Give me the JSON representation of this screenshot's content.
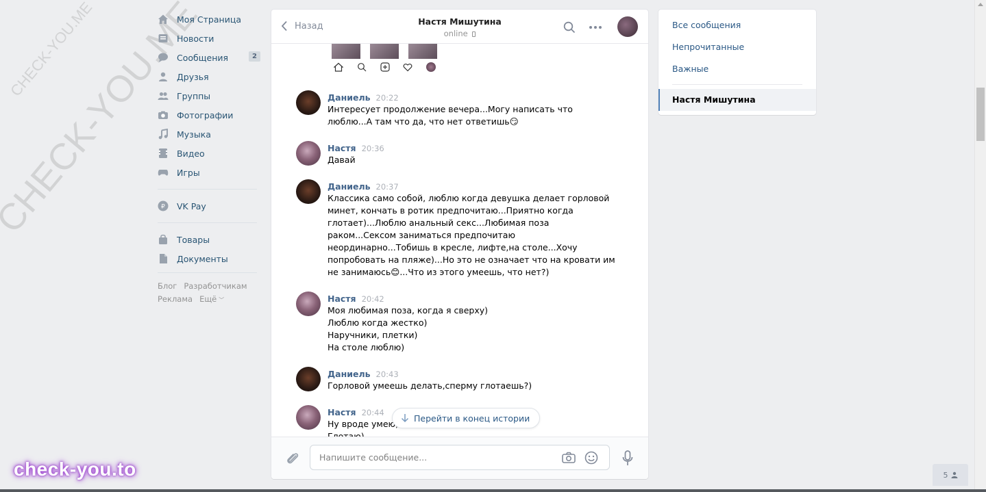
{
  "watermark": {
    "small": "CHECK-YOU.ME",
    "large": "CHECK-YOU.ME",
    "badge": "check-you.to"
  },
  "leftnav": {
    "items": [
      {
        "label": "Моя Страница",
        "icon": "home-icon"
      },
      {
        "label": "Новости",
        "icon": "news-icon"
      },
      {
        "label": "Сообщения",
        "icon": "messages-icon",
        "count": "2"
      },
      {
        "label": "Друзья",
        "icon": "friends-icon"
      },
      {
        "label": "Группы",
        "icon": "groups-icon"
      },
      {
        "label": "Фотографии",
        "icon": "camera-icon"
      },
      {
        "label": "Музыка",
        "icon": "music-icon"
      },
      {
        "label": "Видео",
        "icon": "video-icon"
      },
      {
        "label": "Игры",
        "icon": "games-icon"
      }
    ],
    "vkpay": {
      "label": "VK Pay",
      "icon": "vkpay-icon"
    },
    "extra": [
      {
        "label": "Товары",
        "icon": "bag-icon"
      },
      {
        "label": "Документы",
        "icon": "document-icon"
      }
    ],
    "footer": {
      "blog": "Блог",
      "dev": "Разработчикам",
      "ads": "Реклама",
      "more": "Ещё"
    }
  },
  "chat": {
    "back_label": "Назад",
    "title": "Настя Мишутина",
    "status": "online",
    "messages": [
      {
        "author": "Даниель",
        "time": "20:22",
        "type": "dan",
        "text": "Интересует продолжение вечера...Могу написать что\nлюблю...А там что да, что нет ответишь😏"
      },
      {
        "author": "Настя",
        "time": "20:36",
        "type": "nas",
        "text": "Давай"
      },
      {
        "author": "Даниель",
        "time": "20:37",
        "type": "dan",
        "text": "Классика само собой, люблю когда девушка делает горловой\nминет, кончать в ротик предпочитаю...Приятно когда\nглотает)...Люблю анальный секс...Любимая поза\nраком...Сексом заниматься предпочитаю\nнеординарно...Тобишь в кресле, лифте,на столе...Хочу\nпопробовать на пляже)...Но это не означает что на кровати им\nне занимаюсь😊...Что из этого умеешь, что нет?)"
      },
      {
        "author": "Настя",
        "time": "20:42",
        "type": "nas",
        "text": "Моя любимая поза, когда я сверху)\nЛюблю когда жестко)\nНаручники, плетки)\nНа столе люблю)"
      },
      {
        "author": "Даниель",
        "time": "20:43",
        "type": "dan",
        "text": "Горловой умеешь делать,сперму глотаешь?)"
      },
      {
        "author": "Настя",
        "time": "20:44",
        "type": "nas",
        "text": "Ну вроде умею,\nГлотаю)"
      }
    ],
    "jump_label": "Перейти в конец истории",
    "input_placeholder": "Напишите сообщение..."
  },
  "rightnav": {
    "all": "Все сообщения",
    "unread": "Непрочитанные",
    "important": "Важные",
    "active_chat": "Настя Мишутина"
  },
  "online_count": "5"
}
